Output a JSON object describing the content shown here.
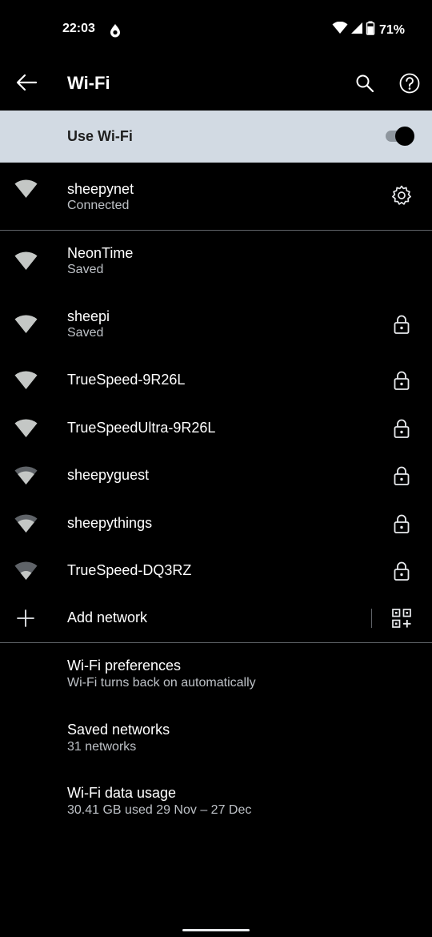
{
  "status_bar": {
    "time": "22:03",
    "battery": "71%",
    "icons": [
      "drop-icon",
      "wifi-signal-icon",
      "cell-signal-icon",
      "battery-icon"
    ]
  },
  "app_bar": {
    "title": "Wi-Fi",
    "icons": [
      "back-arrow-icon",
      "search-icon",
      "help-icon"
    ]
  },
  "master_switch": {
    "label": "Use Wi-Fi",
    "on": true
  },
  "connected": {
    "name": "sheepynet",
    "status": "Connected"
  },
  "networks": [
    {
      "name": "NeonTime",
      "status": "Saved",
      "locked": false
    },
    {
      "name": "sheepi",
      "status": "Saved",
      "locked": true
    },
    {
      "name": "TrueSpeed-9R26L",
      "status": "",
      "locked": true
    },
    {
      "name": "TrueSpeedUltra-9R26L",
      "status": "",
      "locked": true
    },
    {
      "name": "sheepyguest",
      "status": "",
      "locked": true
    },
    {
      "name": "sheepythings",
      "status": "",
      "locked": true
    },
    {
      "name": "TrueSpeed-DQ3RZ",
      "status": "",
      "locked": true
    }
  ],
  "add_network": {
    "label": "Add network"
  },
  "preferences": [
    {
      "title": "Wi-Fi preferences",
      "summary": "Wi-Fi turns back on automatically"
    },
    {
      "title": "Saved networks",
      "summary": "31 networks"
    },
    {
      "title": "Wi-Fi data usage",
      "summary": "30.41 GB used 29 Nov – 27 Dec"
    }
  ],
  "colors": {
    "background": "#000000",
    "master_bar": "#d2dae3",
    "primary_text": "#ffffff",
    "secondary_text": "#bdc1c6",
    "wifi_icon": "#c4c7c5",
    "wifi_icon_empty": "#5f6368"
  }
}
